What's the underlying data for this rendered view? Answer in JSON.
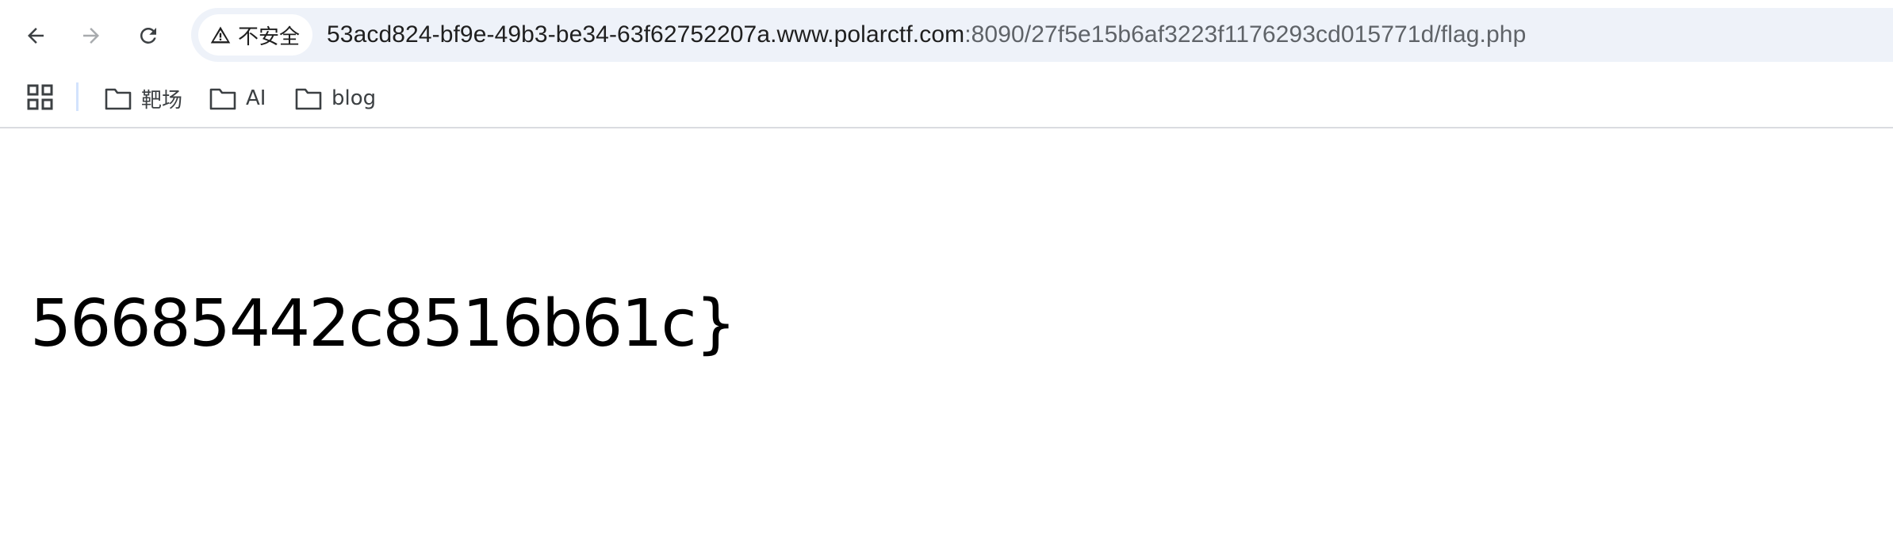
{
  "browser": {
    "nav": {
      "back_icon": "arrow-left-icon",
      "forward_icon": "arrow-right-icon",
      "reload_icon": "reload-icon"
    },
    "omnibox": {
      "security_icon": "warning-triangle-icon",
      "security_label": "不安全",
      "url_host": "53acd824-bf9e-49b3-be34-63f62752207a.www.polarctf.com",
      "url_rest": ":8090/27f5e15b6af3223f1176293cd015771d/flag.php"
    },
    "bookmarks": {
      "apps_icon": "apps-grid-icon",
      "items": [
        {
          "label": "靶场",
          "icon": "folder-icon"
        },
        {
          "label": "AI",
          "icon": "folder-icon"
        },
        {
          "label": "blog",
          "icon": "folder-icon"
        }
      ]
    }
  },
  "page": {
    "body_text": "56685442c8516b61c}"
  },
  "colors": {
    "omnibox_bg": "#eef2f9",
    "text_primary": "#1f1f1f",
    "text_secondary": "#5f6368",
    "separator": "#d3e3fd"
  }
}
